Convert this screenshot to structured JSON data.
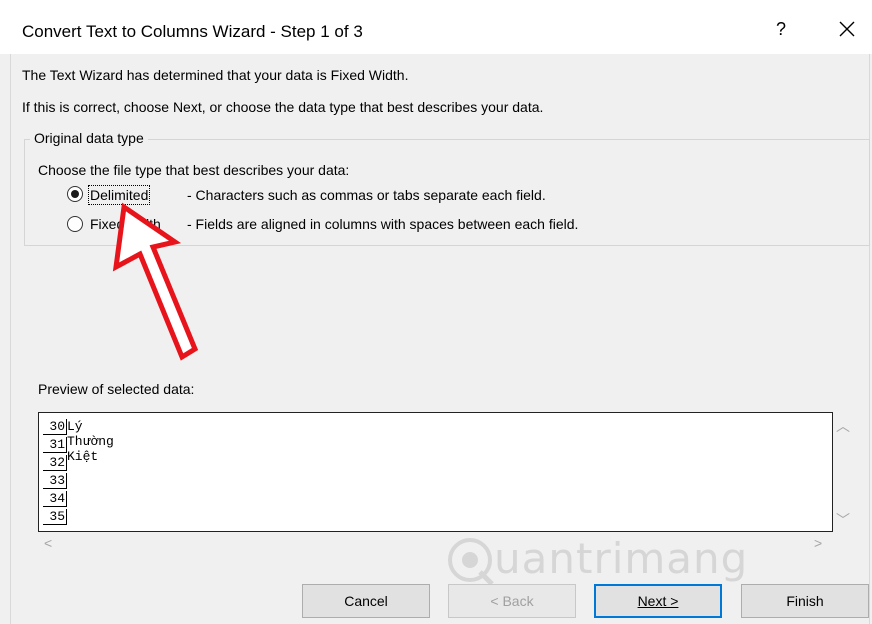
{
  "window": {
    "title": "Convert Text to Columns Wizard - Step 1 of 3",
    "help": "?",
    "close_icon": "close-icon"
  },
  "intro": {
    "line1": "The Text Wizard has determined that your data is Fixed Width.",
    "line2": "If this is correct, choose Next, or choose the data type that best describes your data."
  },
  "group": {
    "legend": "Original data type",
    "prompt": "Choose the file type that best describes your data:",
    "options": [
      {
        "label": "Delimited",
        "description": "- Characters such as commas or tabs separate each field.",
        "selected": true
      },
      {
        "label": "Fixed width",
        "description": "- Fields are aligned in columns with spaces between each field.",
        "selected": false
      }
    ]
  },
  "preview": {
    "label": "Preview of selected data:",
    "rows": [
      {
        "num": "30",
        "text": "Lý Thường Kiệt"
      },
      {
        "num": "31",
        "text": ""
      },
      {
        "num": "32",
        "text": ""
      },
      {
        "num": "33",
        "text": ""
      },
      {
        "num": "34",
        "text": ""
      },
      {
        "num": "35",
        "text": ""
      }
    ]
  },
  "scroll": {
    "up": "︿",
    "down": "﹀",
    "left": "<",
    "right": ">"
  },
  "buttons": {
    "cancel": "Cancel",
    "back": "< Back",
    "next": "Next >",
    "finish": "Finish"
  },
  "watermark": "uantrimang",
  "colors": {
    "accent": "#0078d7",
    "annotation_arrow": "#e8141b"
  }
}
